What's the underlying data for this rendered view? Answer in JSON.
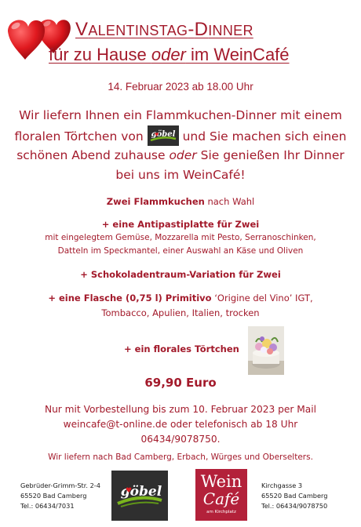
{
  "title": {
    "line1_cap1": "V",
    "line1_rest1": "ALENTINSTAG",
    "line1_sep": "-",
    "line1_cap2": "D",
    "line1_rest2": "INNER",
    "line2_a": "für zu Hause ",
    "line2_em": "oder",
    "line2_b": " im WeinCafé"
  },
  "date": "14. Februar 2023 ab 18.00 Uhr",
  "intro": {
    "part1": "Wir liefern Ihnen ein Flammkuchen-Dinner mit einem floralen Törtchen von",
    "part2": " und Sie machen sich einen schönen Abend zuhause ",
    "em": "oder",
    "part3": " Sie genießen Ihr Dinner bei uns im WeinCafé!"
  },
  "menu": {
    "item1_bold": "Zwei Flammkuchen",
    "item1_rest": " nach Wahl",
    "item2_bold": "+ eine Antipastiplatte für Zwei",
    "item2_desc1": "mit eingelegtem Gemüse, Mozzarella mit Pesto, Serranoschinken,",
    "item2_desc2": "Datteln im Speckmantel, einer Auswahl an Käse und Oliven",
    "item3_bold": "+ Schokoladentraum-Variation für Zwei",
    "item4_bold": "+ eine Flasche (0,75 l) Primitivo",
    "item4_rest1": " ‘Origine del Vino’ IGT,",
    "item4_line2": "Tombacco, Apulien, Italien, trocken",
    "item5_bold": "+ ein florales Törtchen"
  },
  "price": "69,90 Euro",
  "order": {
    "line1": "Nur mit Vorbestellung bis zum 10. Februar 2023 per Mail",
    "line2": "weincafe@t-online.de oder telefonisch ab 18 Uhr",
    "line3": "06434/9078750."
  },
  "delivery": "Wir liefern nach Bad Camberg, Erbach, Würges und Oberselters.",
  "footer": {
    "left_addr": [
      "Gebrüder-Grimm-Str. 2-4",
      "65520 Bad Camberg",
      "Tel.: 06434/7031"
    ],
    "right_addr": [
      "Kirchgasse 3",
      "65520 Bad Camberg",
      "Tel.: 06434/9078750"
    ]
  },
  "logos": {
    "goebel_text": "göbel",
    "weincafe_wein": "Wein",
    "weincafe_cafe": "Café",
    "weincafe_sub": "am Kirchplatz"
  },
  "colors": {
    "primary": "#a31a2b",
    "goebel_bg": "#2f2f2f",
    "goebel_green": "#7ab51d",
    "weincafe_bg": "#b3213a"
  },
  "icons": {
    "hearts": "hearts-icon",
    "cake_photo": "floral-cake-image"
  }
}
